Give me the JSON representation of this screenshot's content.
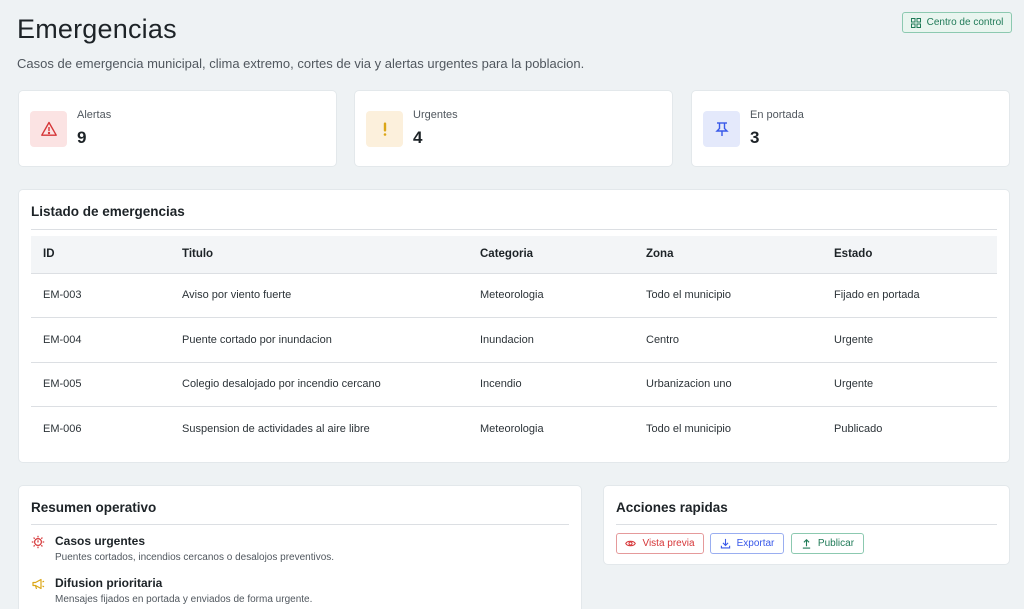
{
  "header": {
    "title": "Emergencias",
    "subtitle": "Casos de emergencia municipal, clima extremo, cortes de via y alertas urgentes para la poblacion.",
    "dashboard_button": "Centro de control"
  },
  "stats": [
    {
      "label": "Alertas",
      "value": "9",
      "icon": "warning-triangle-icon",
      "color": "#d63638"
    },
    {
      "label": "Urgentes",
      "value": "4",
      "icon": "exclamation-icon",
      "color": "#dba617"
    },
    {
      "label": "En portada",
      "value": "3",
      "icon": "pin-icon",
      "color": "#3858e9"
    }
  ],
  "table": {
    "title": "Listado de emergencias",
    "columns": [
      "ID",
      "Titulo",
      "Categoria",
      "Zona",
      "Estado"
    ],
    "rows": [
      [
        "EM-003",
        "Aviso por viento fuerte",
        "Meteorologia",
        "Todo el municipio",
        "Fijado en portada"
      ],
      [
        "EM-004",
        "Puente cortado por inundacion",
        "Inundacion",
        "Centro",
        "Urgente"
      ],
      [
        "EM-005",
        "Colegio desalojado por incendio cercano",
        "Incendio",
        "Urbanizacion uno",
        "Urgente"
      ],
      [
        "EM-006",
        "Suspension de actividades al aire libre",
        "Meteorologia",
        "Todo el municipio",
        "Publicado"
      ]
    ]
  },
  "summary": {
    "title": "Resumen operativo",
    "items": [
      {
        "title": "Casos urgentes",
        "desc": "Puentes cortados, incendios cercanos o desalojos preventivos.",
        "icon": "alert-burst-icon"
      },
      {
        "title": "Difusion prioritaria",
        "desc": "Mensajes fijados en portada y enviados de forma urgente.",
        "icon": "megaphone-icon"
      }
    ]
  },
  "actions": {
    "title": "Acciones rapidas",
    "preview": "Vista previa",
    "export": "Exportar",
    "publish": "Publicar"
  },
  "colors": {
    "accent_green": "#1f7a57",
    "danger": "#d63638",
    "warning": "#dba617",
    "info": "#3858e9",
    "success": "#00a32a"
  }
}
